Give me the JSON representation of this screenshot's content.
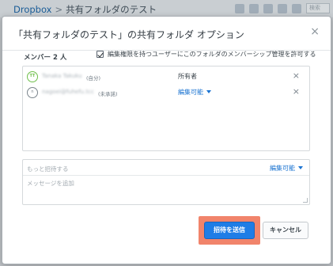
{
  "background": {
    "breadcrumb_root": "Dropbox",
    "breadcrumb_separator": ">",
    "breadcrumb_current": "共有フォルダのテスト",
    "search_placeholder": "検索"
  },
  "dialog": {
    "title": "「共有フォルダのテスト」の共有フォルダ オプション",
    "close_label": "×",
    "member_count_label": "メンバー 2 人",
    "allow_editors_label": "編集権限を持つユーザーにこのフォルダのメンバーシップ管理を許可する",
    "allow_editors_checked": true,
    "members": [
      {
        "initials": "TT",
        "name": "Tanaka Takuku",
        "suffix": "(自分)",
        "role": "所有者",
        "role_editable": false,
        "remove": "×"
      },
      {
        "initials": "n",
        "name": "nagoei@fuhefu.tcc",
        "suffix": "(未承諾)",
        "role": "編集可能",
        "role_editable": true,
        "remove": "×"
      }
    ],
    "invite": {
      "placeholder": "もっと招待する",
      "role": "編集可能",
      "message_placeholder": "メッセージを追加"
    },
    "send_button": "招待を送信",
    "cancel_button": "キャンセル"
  },
  "colors": {
    "accent_blue": "#1f7de6",
    "highlight": "#f1846b",
    "owner_avatar": "#6fbf4a"
  }
}
